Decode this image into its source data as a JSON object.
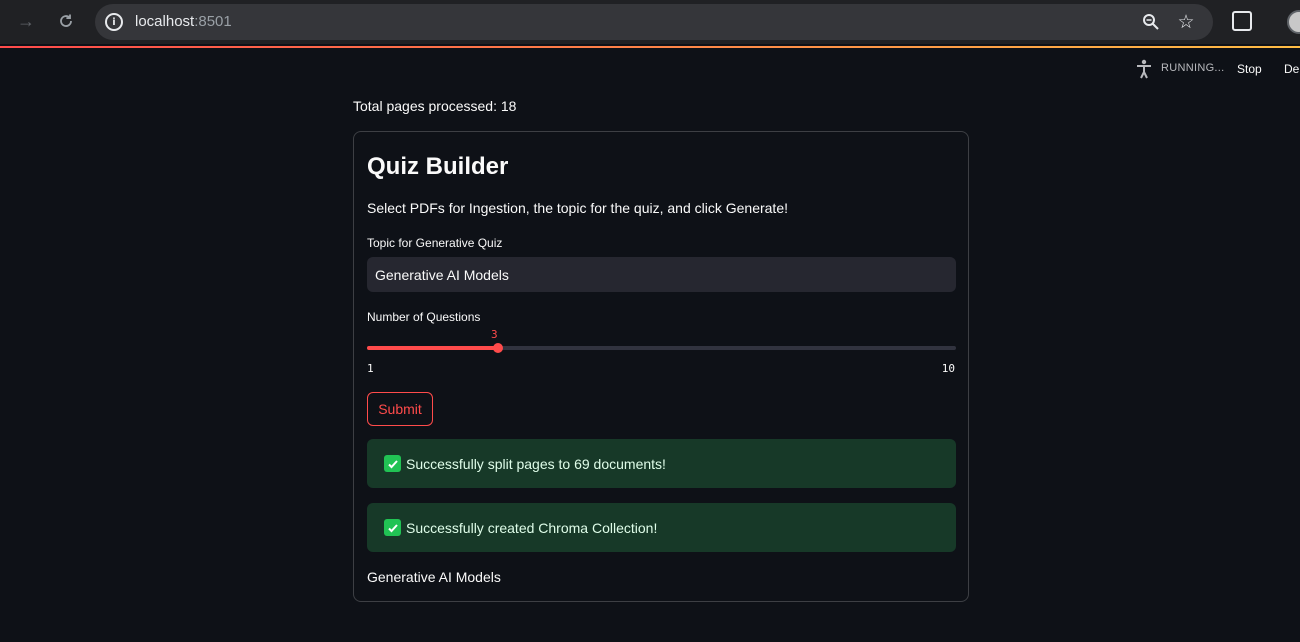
{
  "browser": {
    "url_host": "localhost",
    "url_port": ":8501"
  },
  "header": {
    "status": "RUNNING...",
    "stop_label": "Stop",
    "deploy_label": "Deploy"
  },
  "main": {
    "total_pages": "Total pages processed: 18"
  },
  "form": {
    "title": "Quiz Builder",
    "description": "Select PDFs for Ingestion, the topic for the quiz, and click Generate!",
    "topic_label": "Topic for Generative Quiz",
    "topic_value": "Generative AI Models",
    "num_questions_label": "Number of Questions",
    "slider": {
      "value": "3",
      "min": "1",
      "max": "10"
    },
    "submit_label": "Submit"
  },
  "alerts": [
    {
      "text": "Successfully split pages to 69 documents!"
    },
    {
      "text": "Successfully created Chroma Collection!"
    }
  ],
  "result": {
    "topic": "Generative AI Models"
  },
  "colors": {
    "primary": "#ff4b4b",
    "background": "#0e1117",
    "success": "#21c354"
  }
}
